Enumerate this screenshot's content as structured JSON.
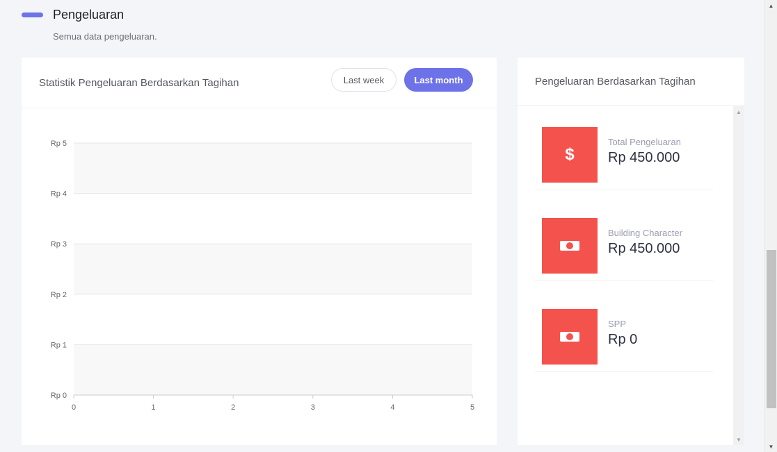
{
  "header": {
    "title": "Pengeluaran",
    "subtitle": "Semua data pengeluaran."
  },
  "chart_card": {
    "title": "Statistik Pengeluaran Berdasarkan Tagihan",
    "buttons": {
      "last_week": "Last week",
      "last_month": "Last month",
      "active": "last_month"
    }
  },
  "chart_data": {
    "type": "line",
    "title": "",
    "x": [],
    "series": [],
    "xticks": [
      "0",
      "1",
      "2",
      "3",
      "4",
      "5"
    ],
    "yticks": [
      "Rp 0",
      "Rp 1",
      "Rp 2",
      "Rp 3",
      "Rp 4",
      "Rp 5"
    ],
    "xlim": [
      0,
      5
    ],
    "ylim": [
      0,
      5
    ],
    "grid": true,
    "colors": {
      "band": "#f8f8f8",
      "gridline": "#e6e6e6",
      "tick_text": "#666666"
    }
  },
  "stats_card": {
    "title": "Pengeluaran Berdasarkan Tagihan",
    "items": [
      {
        "label": "Total Pengeluaran",
        "value": "Rp 450.000",
        "icon": "dollar-icon",
        "icon_text": "$"
      },
      {
        "label": "Building Character",
        "value": "Rp 450.000",
        "icon": "money-bill-icon"
      },
      {
        "label": "SPP",
        "value": "Rp 0",
        "icon": "money-bill-icon"
      }
    ]
  },
  "colors": {
    "accent": "#6d72e8",
    "danger": "#f4524d",
    "background": "#f4f5f8",
    "card": "#ffffff"
  }
}
